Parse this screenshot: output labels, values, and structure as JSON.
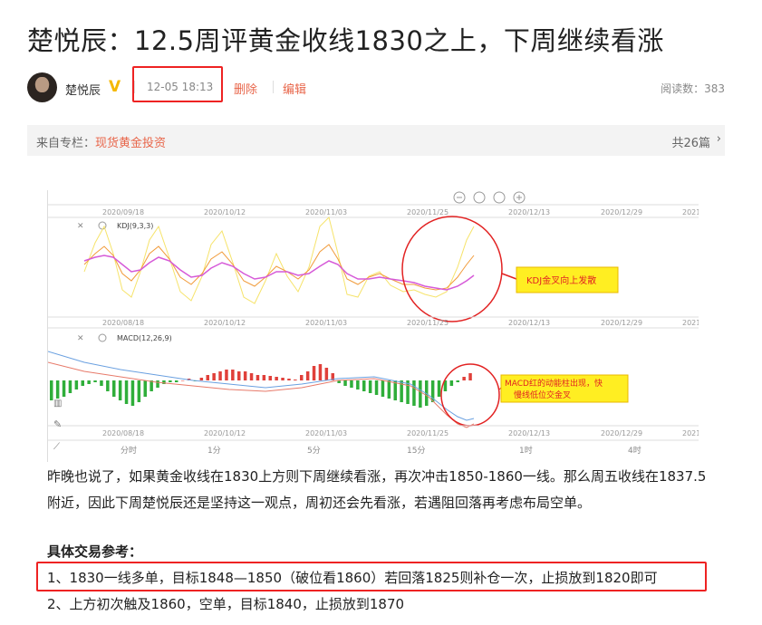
{
  "article": {
    "title": "楚悦辰：12.5周评黄金收线1830之上，下周继续看涨",
    "author": "楚悦辰",
    "verified_badge": "V",
    "time": "12-05 18:13",
    "delete_label": "删除",
    "edit_label": "编辑",
    "reads_label": "阅读数：",
    "reads_count": "383"
  },
  "column": {
    "prefix": "来自专栏：",
    "name": "现货黄金投资",
    "count": "共26篇",
    "chevron": "›"
  },
  "chart": {
    "top_dates": [
      "2020/09/18",
      "2020/10/12",
      "2020/11/03",
      "2020/11/25",
      "2020/12/13",
      "2020/12/29",
      "2021/"
    ],
    "mid_dates": [
      "2020/08/18",
      "2020/10/12",
      "2020/11/03",
      "2020/11/25",
      "2020/12/13",
      "2020/12/29",
      "2021/"
    ],
    "bottom_dates": [
      "2020/08/18",
      "2020/10/12",
      "2020/11/03",
      "2020/11/25",
      "2020/12/13",
      "2020/12/29",
      "2021/"
    ],
    "kdj_label": "KDJ(9,3,3)",
    "macd_label": "MACD(12,26,9)",
    "kdj_note": "KDJ金叉向上发散",
    "macd_note_line1": "MACD红的动能柱出现，快",
    "macd_note_line2": "慢线低位交金叉",
    "timeframes": [
      "分时",
      "1分",
      "5分",
      "15分",
      "1时",
      "4时"
    ],
    "colors": {
      "up": "#e0403a",
      "down": "#2fae3a",
      "note_bg": "#ffee22",
      "circle": "#e22222"
    }
  },
  "body": {
    "paragraph": "昨晚也说了，如果黄金收线在1830上方则下周继续看涨，再次冲击1850-1860一线。那么周五收线在1837.5附近，因此下周楚悦辰还是坚持这一观点，周初还会先看涨，若遇阻回落再考虑布局空单。",
    "strategy_heading": "具体交易参考：",
    "item1": "1、1830一线多单，目标1848—1850（破位看1860）若回落1825则补仓一次，止损放到1820即可",
    "item2": "2、上方初次触及1860，空单，目标1840，止损放到1870"
  }
}
